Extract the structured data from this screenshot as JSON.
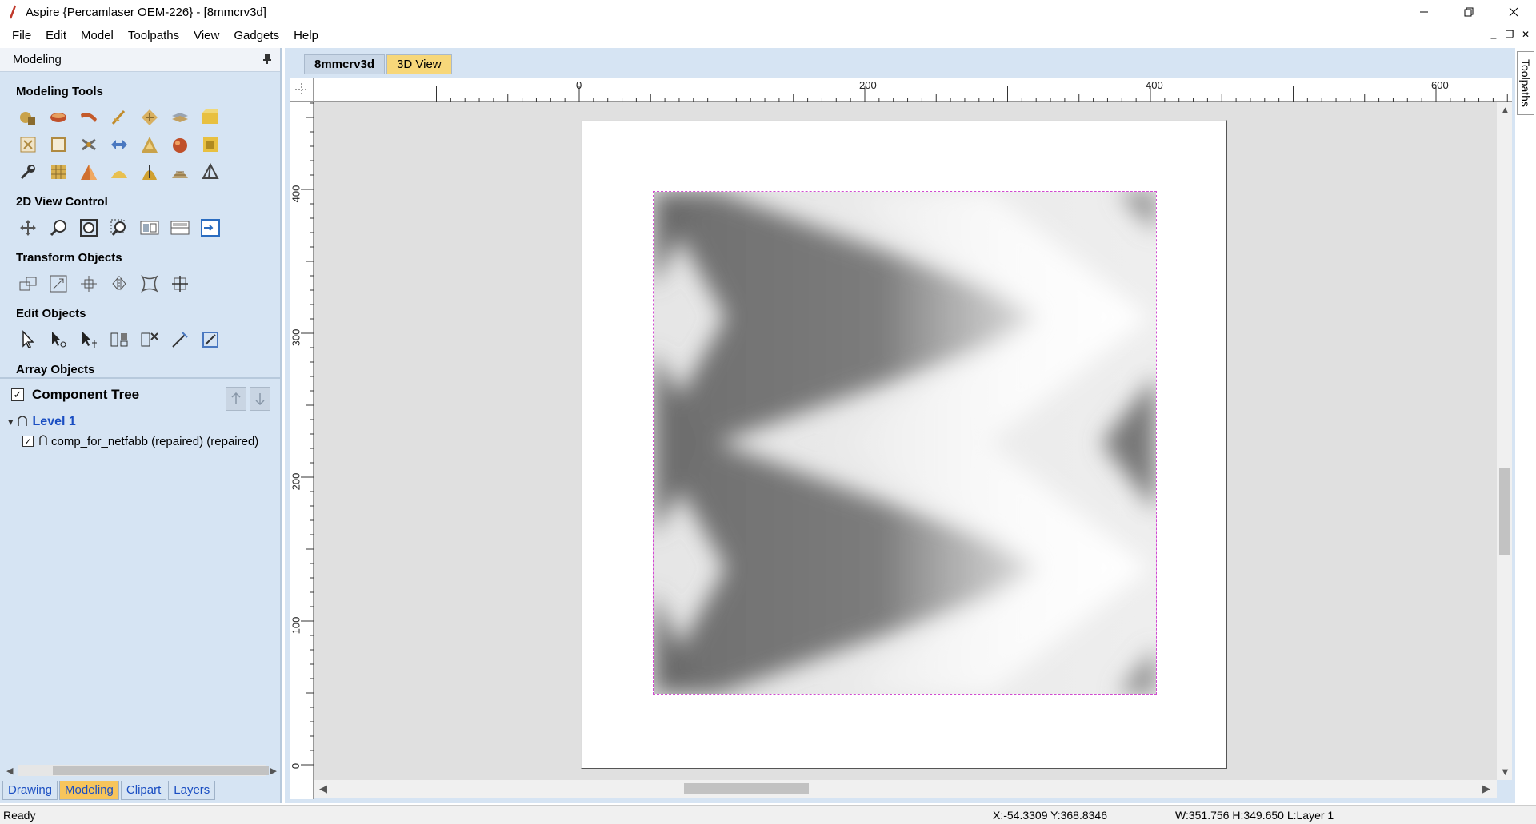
{
  "window": {
    "title": "Aspire {Percamlaser OEM-226} - [8mmcrv3d]",
    "controls": [
      "minimize",
      "restore",
      "close"
    ]
  },
  "menu": [
    "File",
    "Edit",
    "Model",
    "Toolpaths",
    "View",
    "Gadgets",
    "Help"
  ],
  "left_panel": {
    "header": "Modeling",
    "sections": {
      "modeling_tools": "Modeling Tools",
      "view_control": "2D View Control",
      "transform": "Transform Objects",
      "edit": "Edit Objects",
      "array": "Array Objects"
    },
    "component_tree": {
      "title": "Component Tree",
      "level": "Level 1",
      "item": "comp_for_netfabb (repaired) (repaired)"
    },
    "tabs": [
      "Drawing",
      "Modeling",
      "Clipart",
      "Layers"
    ],
    "active_tab": "Modeling"
  },
  "view_tabs": [
    "8mmcrv3d",
    "3D View"
  ],
  "active_view_tab": "8mmcrv3d",
  "ruler": {
    "top_labels": [
      "0",
      "200",
      "400",
      "600"
    ],
    "left_labels": [
      "400",
      "300",
      "200",
      "100",
      "0"
    ]
  },
  "right_tab": "Toolpaths",
  "status": {
    "ready": "Ready",
    "coords": "X:-54.3309 Y:368.8346",
    "size": "W:351.756   H:349.650  L:Layer 1"
  },
  "colors": {
    "panel_bg": "#d6e4f3",
    "active_tab": "#f7c55c",
    "link_blue": "#1a4ec2",
    "selection_dash": "#d04bd0"
  }
}
